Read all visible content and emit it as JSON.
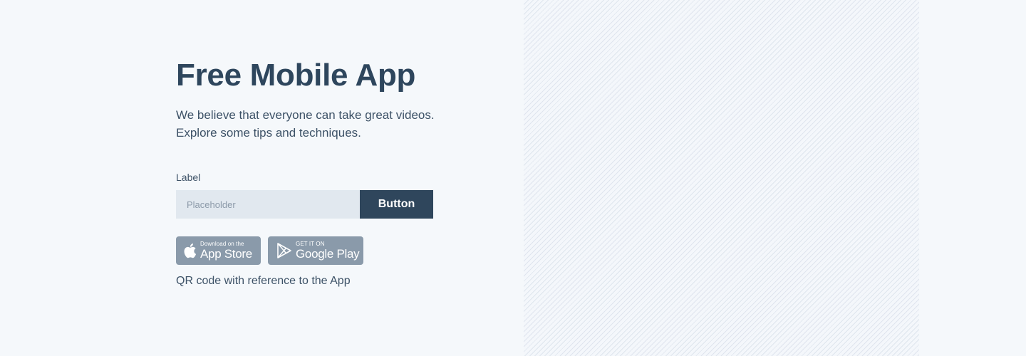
{
  "hero": {
    "title": "Free Mobile App",
    "description_lines": [
      "We believe that everyone can take great videos.",
      "Explore some tips and techniques."
    ]
  },
  "form": {
    "label": "Label",
    "input_placeholder": "Placeholder",
    "input_value": "",
    "button_label": "Button"
  },
  "stores": {
    "apple": {
      "icon": "apple-icon",
      "small_text": "Download on the",
      "big_text": "App Store"
    },
    "google": {
      "icon": "google-play-icon",
      "small_text": "GET IT ON",
      "big_text": "Google Play"
    }
  },
  "qr_note": "QR code with reference to the App",
  "colors": {
    "background": "#f5f8fb",
    "text_primary": "#2e465d",
    "input_background": "#e1e8ef",
    "button_background": "#2f465c",
    "store_badge": "#8a9aaa",
    "pattern_stripe": "#dfe5ee"
  }
}
